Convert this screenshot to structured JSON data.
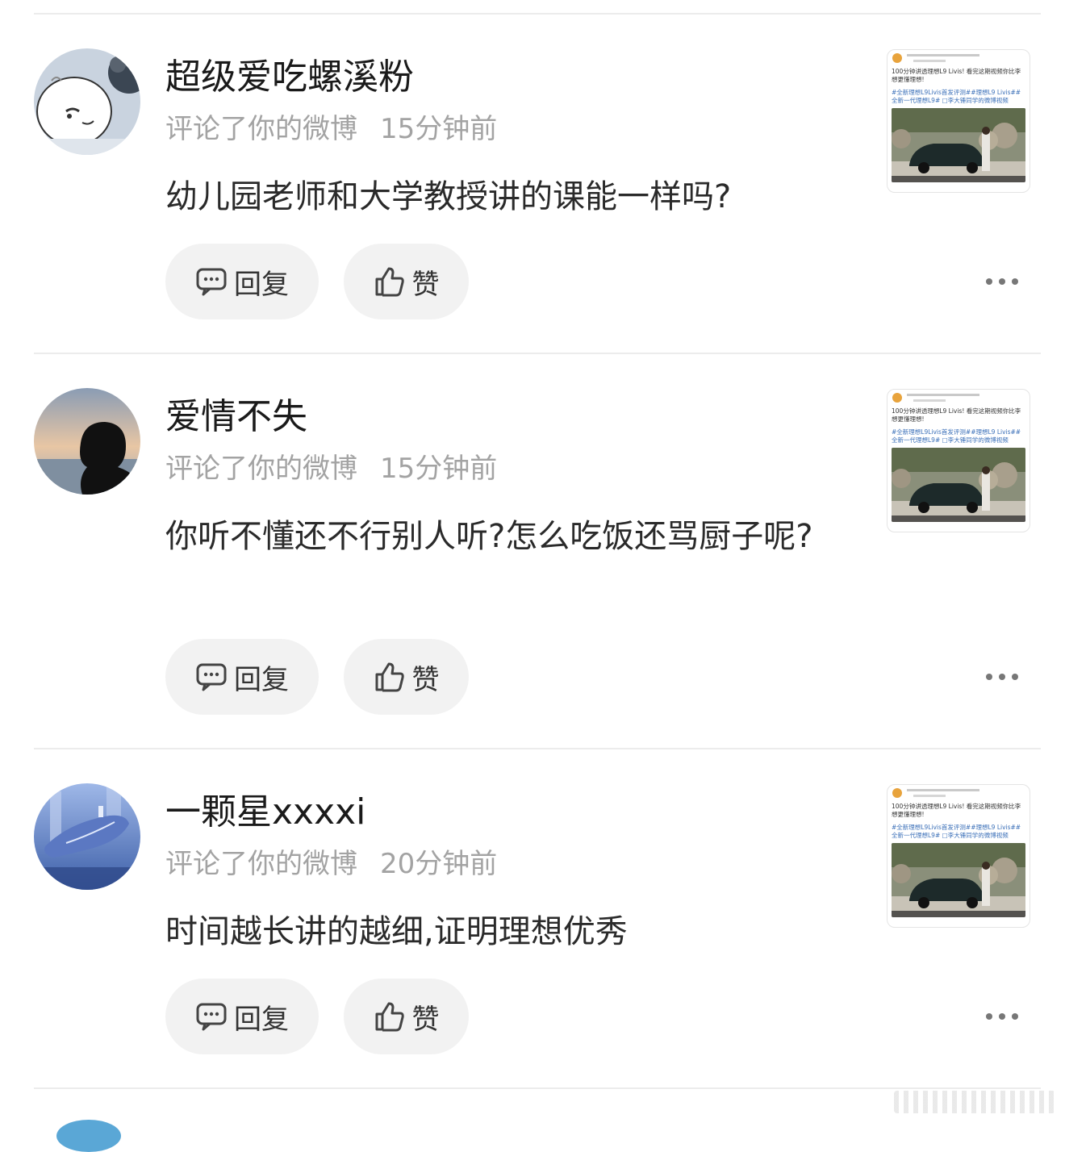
{
  "comments": [
    {
      "username": "超级爱吃螺溪粉",
      "action": "评论了你的微博",
      "time": "15分钟前",
      "text": "幼儿园老师和大学教授讲的课能一样吗?",
      "reply_label": "回复",
      "like_label": "赞",
      "avatar": "cartoon-face-avatar",
      "thumbnail": {
        "caption": "100分钟讲透理想L9 Livis! 看完这期视频你比李想更懂理想!",
        "tags": "#全新理想L9Livis首发评测##理想L9 Livis##全新一代理想L9# □李大锤同学的微博视频"
      }
    },
    {
      "username": "爱情不失",
      "action": "评论了你的微博",
      "time": "15分钟前",
      "text": "你听不懂还不行别人听?怎么吃饭还骂厨子呢?",
      "reply_label": "回复",
      "like_label": "赞",
      "avatar": "silhouette-portrait-avatar",
      "thumbnail": {
        "caption": "100分钟讲透理想L9 Livis! 看完这期视频你比李想更懂理想!",
        "tags": "#全新理想L9Livis首发评测##理想L9 Livis##全新一代理想L9# □李大锤同学的微博视频"
      }
    },
    {
      "username": "一颗星xxxxi",
      "action": "评论了你的微博",
      "time": "20分钟前",
      "text": "时间越长讲的越细,证明理想优秀",
      "reply_label": "回复",
      "like_label": "赞",
      "avatar": "whale-illustration-avatar",
      "thumbnail": {
        "caption": "100分钟讲透理想L9 Livis! 看完这期视频你比李想更懂理想!",
        "tags": "#全新理想L9Livis首发评测##理想L9 Livis##全新一代理想L9# □李大锤同学的微博视频"
      }
    }
  ],
  "colors": {
    "pill_bg": "#f2f2f2",
    "meta_text": "#a3a3a3",
    "divider": "#ececec",
    "tag_blue": "#3a6fb8"
  }
}
